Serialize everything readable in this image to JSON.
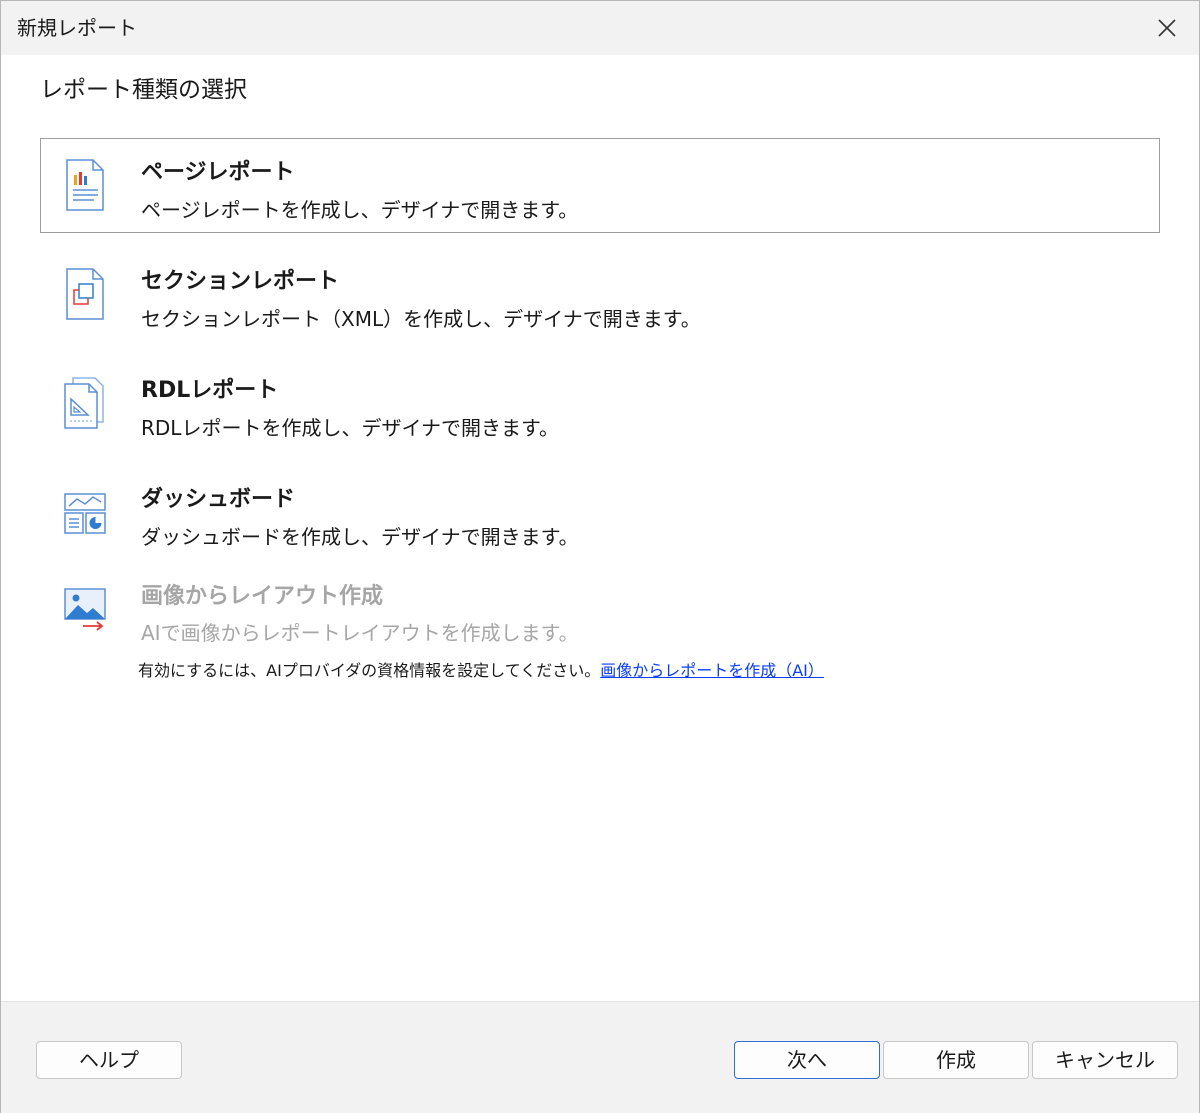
{
  "window": {
    "title": "新規レポート"
  },
  "main": {
    "heading": "レポート種類の選択",
    "options": [
      {
        "title": "ページレポート",
        "description": "ページレポートを作成し、デザイナで開きます。",
        "icon": "page-report-icon",
        "selected": true,
        "enabled": true
      },
      {
        "title": "セクションレポート",
        "description": "セクションレポート（XML）を作成し、デザイナで開きます。",
        "icon": "section-report-icon",
        "selected": false,
        "enabled": true
      },
      {
        "title": "RDLレポート",
        "description": "RDLレポートを作成し、デザイナで開きます。",
        "icon": "rdl-report-icon",
        "selected": false,
        "enabled": true
      },
      {
        "title": "ダッシュボード",
        "description": "ダッシュボードを作成し、デザイナで開きます。",
        "icon": "dashboard-icon",
        "selected": false,
        "enabled": true
      },
      {
        "title": "画像からレイアウト作成",
        "description": "AIで画像からレポートレイアウトを作成します。",
        "icon": "image-layout-icon",
        "selected": false,
        "enabled": false
      }
    ],
    "ai_note": {
      "text": "有効にするには、AIプロバイダの資格情報を設定してください。",
      "link": "画像からレポートを作成（AI）"
    }
  },
  "footer": {
    "help_label": "ヘルプ",
    "next_label": "次へ",
    "create_label": "作成",
    "cancel_label": "キャンセル"
  },
  "colors": {
    "accent": "#2c6fd1",
    "link": "#0a3cff",
    "disabled_text": "#a6a6a6",
    "icon_red": "#e53935",
    "icon_blue": "#2e7dd1"
  }
}
